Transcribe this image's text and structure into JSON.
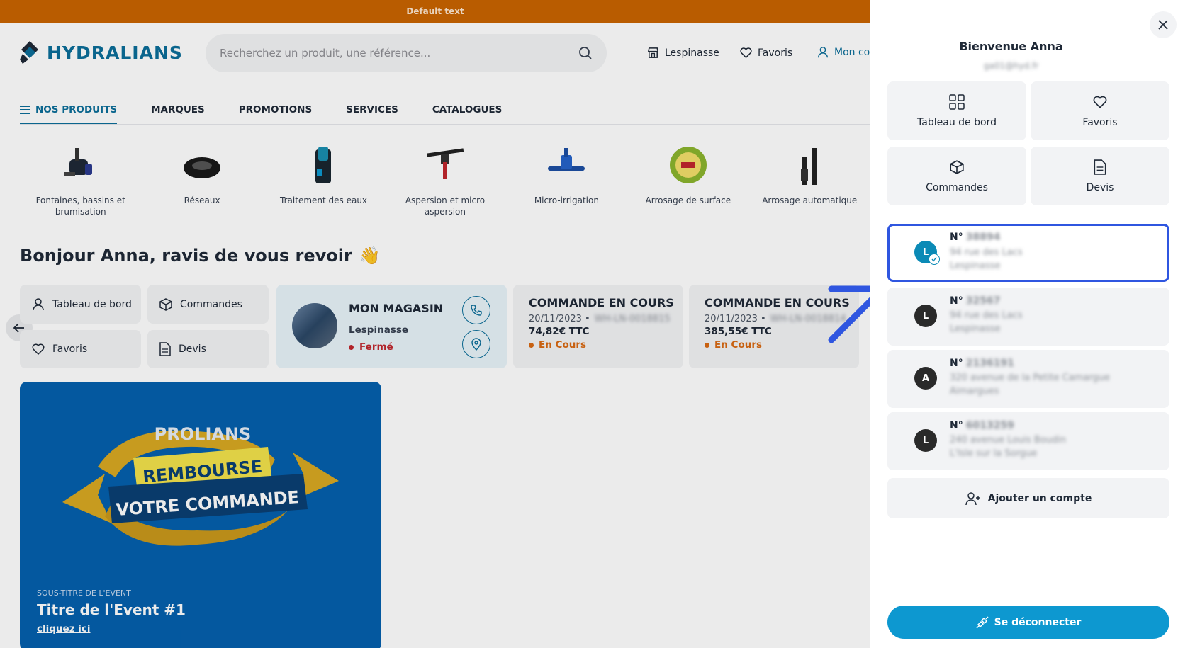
{
  "banner": {
    "text": "Default text"
  },
  "header": {
    "brand": "HYDRALIANS",
    "search_placeholder": "Recherchez un produit, une référence...",
    "store_link": "Lespinasse",
    "favorites_link": "Favoris",
    "account_link": "Mon co"
  },
  "nav": {
    "items": [
      {
        "label": "NOS PRODUITS",
        "active": true
      },
      {
        "label": "MARQUES"
      },
      {
        "label": "PROMOTIONS"
      },
      {
        "label": "SERVICES"
      },
      {
        "label": "CATALOGUES"
      }
    ]
  },
  "categories": [
    {
      "label": "Fontaines, bassins et brumisation"
    },
    {
      "label": "Réseaux"
    },
    {
      "label": "Traitement des eaux"
    },
    {
      "label": "Aspersion et micro aspersion"
    },
    {
      "label": "Micro-irrigation"
    },
    {
      "label": "Arrosage de surface"
    },
    {
      "label": "Arrosage automatique"
    }
  ],
  "greeting": "Bonjour Anna, ravis de vous revoir",
  "greeting_emoji": "👋",
  "quick": {
    "dashboard": "Tableau de bord",
    "orders": "Commandes",
    "favorites": "Favoris",
    "quotes": "Devis"
  },
  "store": {
    "title": "MON MAGASIN",
    "city": "Lespinasse",
    "status": "Fermé"
  },
  "orders": [
    {
      "title": "COMMANDE EN COURS",
      "date": "20/11/2023 •",
      "ref": "WH-LN-0018815",
      "amount": "74,82€ TTC",
      "status": "En Cours"
    },
    {
      "title": "COMMANDE EN COURS",
      "date": "20/11/2023 •",
      "ref": "WH-LN-0018814",
      "amount": "385,55€ TTC",
      "status": "En Cours"
    }
  ],
  "event": {
    "line1": "PROLIANS",
    "line2": "REMBOURSE",
    "line3": "VOTRE COMMANDE",
    "subtitle": "SOUS-TITRE DE L'EVENT",
    "title": "Titre de l'Event #1",
    "link": "cliquez ici"
  },
  "panel": {
    "welcome": "Bienvenue Anna",
    "email": "ga01@hyd.fr",
    "tiles": {
      "dashboard": "Tableau de bord",
      "favorites": "Favoris",
      "orders": "Commandes",
      "quotes": "Devis"
    },
    "accounts": [
      {
        "initial": "L",
        "no_label": "N°",
        "number": "38894",
        "line1": "94 rue des Lacs",
        "line2": "Lespinasse",
        "selected": true
      },
      {
        "initial": "L",
        "no_label": "N°",
        "number": "32567",
        "line1": "94 rue des Lacs",
        "line2": "Lespinasse",
        "selected": false
      },
      {
        "initial": "A",
        "no_label": "N°",
        "number": "2136191",
        "line1": "320 avenue de la Petite Camargue",
        "line2": "Aimargues",
        "selected": false
      },
      {
        "initial": "L",
        "no_label": "N°",
        "number": "6013259",
        "line1": "240 avenue Louis Boudin",
        "line2": "L'Isle sur la Sorgue",
        "selected": false
      }
    ],
    "add_account": "Ajouter un compte",
    "logout": "Se déconnecter"
  },
  "colors": {
    "brand": "#0b6e99",
    "banner": "#c96400",
    "logout": "#0d98d0",
    "highlight": "#2f56e0",
    "closed": "#c0262d",
    "in_progress": "#d96a13"
  }
}
